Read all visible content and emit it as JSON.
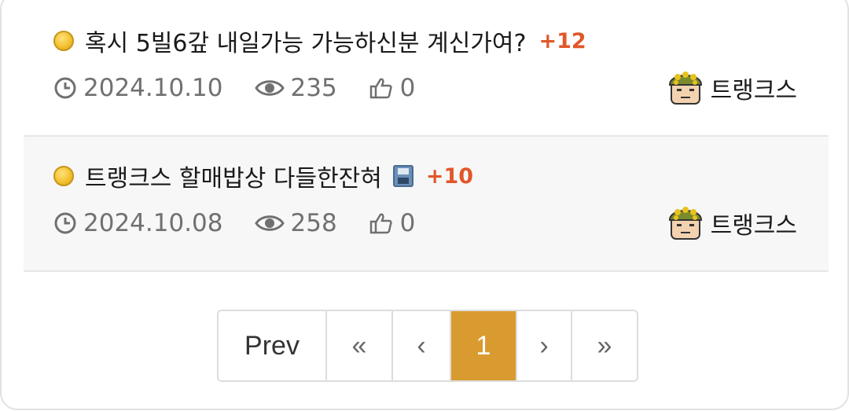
{
  "posts": [
    {
      "title": "혹시 5빌6갚 내일가능 가능하신분 계신가여?",
      "comment_count": "+12",
      "has_attachment_icon": false,
      "date": "2024.10.10",
      "views": "235",
      "likes": "0",
      "author": "트랭크스"
    },
    {
      "title": "트랭크스 할매밥상 다들한잔혀",
      "comment_count": "+10",
      "has_attachment_icon": true,
      "date": "2024.10.08",
      "views": "258",
      "likes": "0",
      "author": "트랭크스"
    }
  ],
  "pagination": {
    "prev_label": "Prev",
    "first_label": "«",
    "back_label": "‹",
    "current_page": "1",
    "next_label": "›",
    "last_label": "»"
  },
  "colors": {
    "accent": "#d99b2f",
    "comment_count": "#e0572a",
    "meta_text": "#707070"
  },
  "icons": [
    "coin-icon",
    "clock-icon",
    "eye-icon",
    "thumbs-up-icon",
    "avatar-icon",
    "floppy-disk-icon"
  ]
}
